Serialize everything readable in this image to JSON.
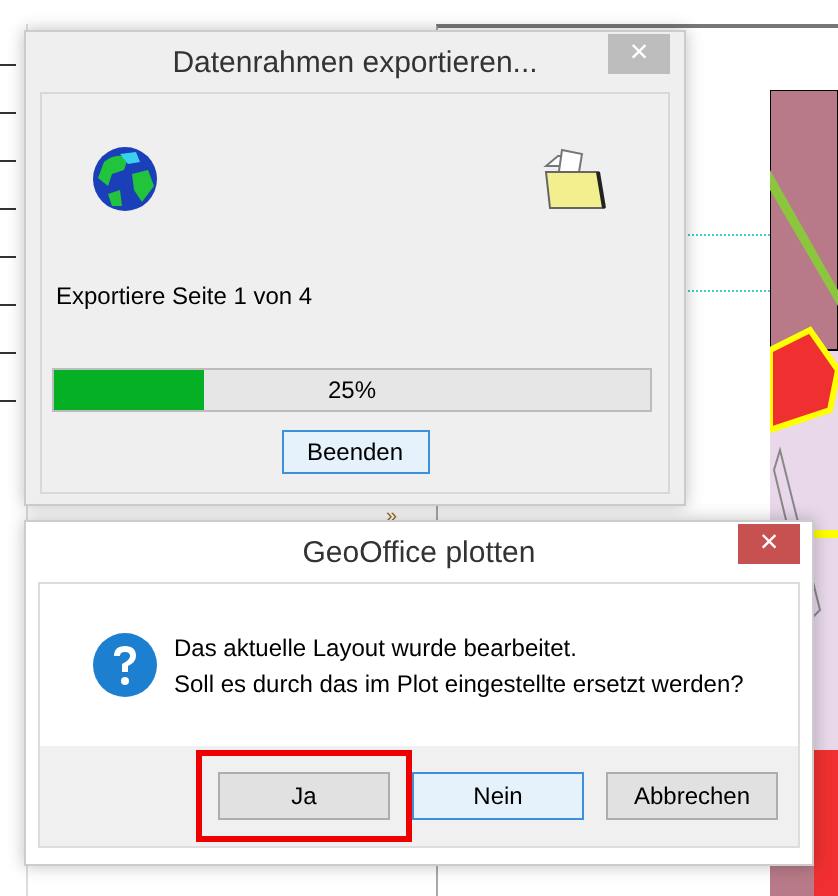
{
  "background": {
    "toolbar_mark": "»"
  },
  "progress_dialog": {
    "title": "Datenrahmen exportieren...",
    "close": "×",
    "status": "Exportiere Seite 1 von 4",
    "progress": {
      "level": 0.25,
      "reading": "25%"
    },
    "buttons": [
      {
        "label": "Beenden",
        "focused": true
      }
    ]
  },
  "confirm_dialog": {
    "title": "GeoOffice plotten",
    "close": "×",
    "message": [
      "Das aktuelle Layout wurde bearbeitet.",
      "Soll es durch das im Plot eingestellte ersetzt werden?"
    ],
    "buttons": [
      {
        "label": "Ja",
        "focused": false,
        "highlighted": true
      },
      {
        "label": "Nein",
        "focused": true,
        "highlighted": false
      },
      {
        "label": "Abbrechen",
        "focused": false,
        "highlighted": false
      }
    ]
  }
}
